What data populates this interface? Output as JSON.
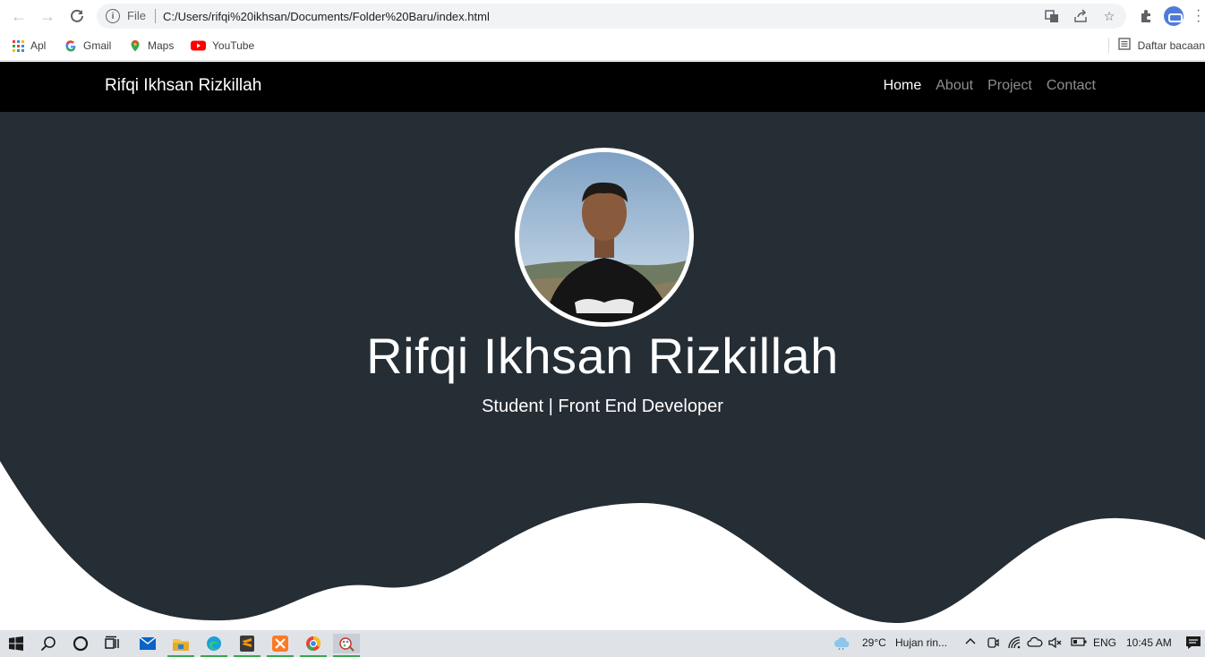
{
  "browser": {
    "url_scheme": "File",
    "url": "C:/Users/rifqi%20ikhsan/Documents/Folder%20Baru/index.html",
    "bookmarks": [
      {
        "label": "Apl",
        "icon": "apps-grid-icon"
      },
      {
        "label": "Gmail",
        "icon": "google-icon"
      },
      {
        "label": "Maps",
        "icon": "maps-pin-icon"
      },
      {
        "label": "YouTube",
        "icon": "youtube-icon"
      }
    ],
    "reading_list": "Daftar bacaan"
  },
  "page": {
    "brand": "Rifqi Ikhsan Rizkillah",
    "nav": [
      {
        "label": "Home",
        "active": true
      },
      {
        "label": "About",
        "active": false
      },
      {
        "label": "Project",
        "active": false
      },
      {
        "label": "Contact",
        "active": false
      }
    ],
    "hero_name": "Rifqi Ikhsan Rizkillah",
    "hero_subtitle": "Student | Front End Developer",
    "colors": {
      "navbar": "#000000",
      "hero_bg": "#252d35",
      "wave": "#ffffff"
    }
  },
  "taskbar": {
    "weather_temp": "29°C",
    "weather_text": "Hujan rin...",
    "language": "ENG",
    "time": "10:45 AM"
  }
}
